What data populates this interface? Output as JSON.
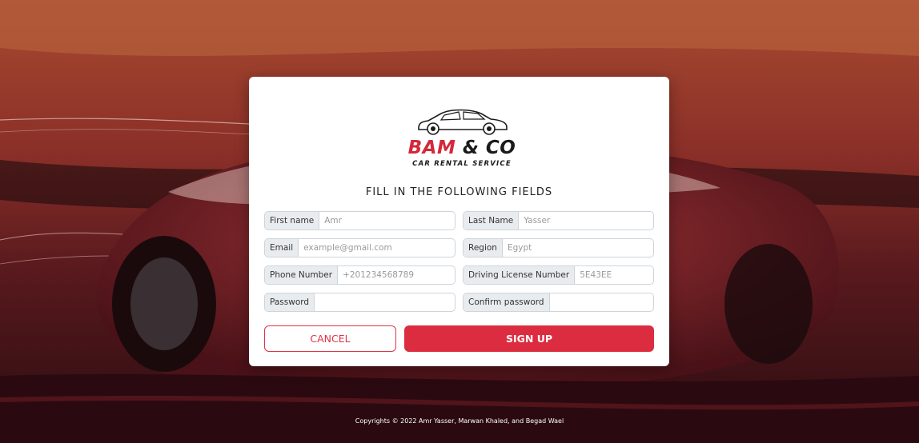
{
  "brand": {
    "name_part1": "BAM",
    "name_part2": "& CO",
    "tagline": "CAR RENTAL SERVICE"
  },
  "form": {
    "heading": "FILL IN THE FOLLOWING FIELDS",
    "fields": {
      "first_name": {
        "label": "First name",
        "placeholder": "Amr"
      },
      "last_name": {
        "label": "Last Name",
        "placeholder": "Yasser"
      },
      "email": {
        "label": "Email",
        "placeholder": "example@gmail.com"
      },
      "region": {
        "label": "Region",
        "placeholder": "Egypt"
      },
      "phone": {
        "label": "Phone Number",
        "placeholder": "+201234568789"
      },
      "license": {
        "label": "Driving License Number",
        "placeholder": "5E43EE"
      },
      "password": {
        "label": "Password",
        "placeholder": ""
      },
      "confirm_password": {
        "label": "Confirm password",
        "placeholder": ""
      }
    },
    "cancel_label": "CANCEL",
    "signup_label": "SIGN UP"
  },
  "footer": {
    "copyright": "Copyrights © 2022 Amr Yasser, Marwan Khaled, and Begad Wael"
  },
  "colors": {
    "accent": "#dc2d40",
    "background_dark": "#3a0f12",
    "background_warm": "#b8553a"
  }
}
